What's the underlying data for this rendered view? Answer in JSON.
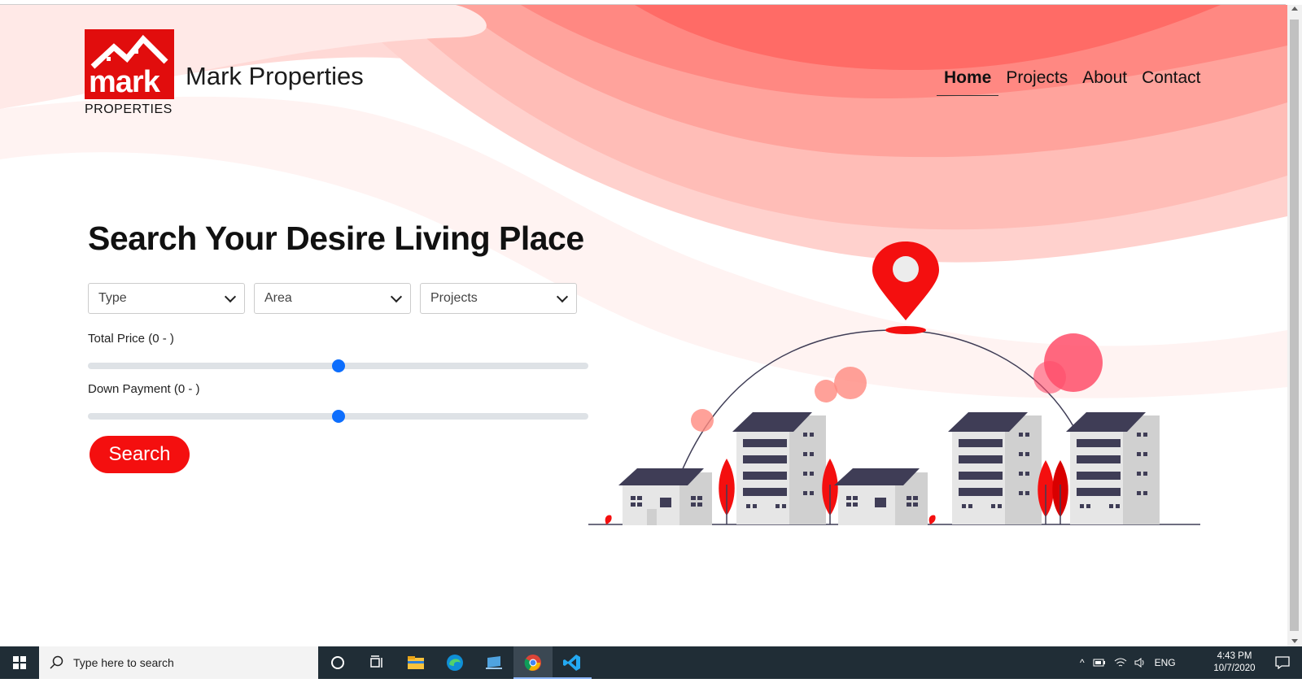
{
  "site": {
    "logo_word": "mark",
    "logo_sub": "PROPERTIES",
    "brand_name": "Mark Properties"
  },
  "nav": {
    "items": [
      {
        "label": "Home",
        "active": true
      },
      {
        "label": "Projects",
        "active": false
      },
      {
        "label": "About",
        "active": false
      },
      {
        "label": "Contact",
        "active": false
      }
    ]
  },
  "hero": {
    "heading": "Search Your Desire Living Place",
    "selects": [
      {
        "value": "Type"
      },
      {
        "value": "Area"
      },
      {
        "value": "Projects"
      }
    ],
    "total_price": {
      "label": "Total Price (0 - )",
      "value_fraction": 0.5
    },
    "down_payment": {
      "label": "Down Payment (0 - )",
      "value_fraction": 0.5
    },
    "search_label": "Search"
  },
  "colors": {
    "accent": "#f40f0f",
    "slider": "#0d6efd",
    "building_roof": "#3f3d56",
    "building_wall": "#e6e6e6"
  },
  "taskbar": {
    "search_placeholder": "Type here to search",
    "language": "ENG",
    "time": "4:43 PM",
    "date": "10/7/2020",
    "pinned": [
      "task-view-icon",
      "file-explorer-icon",
      "edge-icon",
      "store-icon",
      "chrome-icon",
      "vscode-icon"
    ]
  }
}
